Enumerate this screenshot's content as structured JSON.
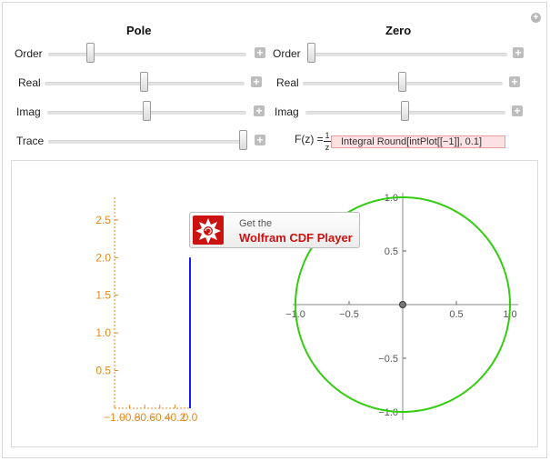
{
  "pole": {
    "title": "Pole",
    "rows": [
      {
        "label": "Order",
        "value": 0.22
      },
      {
        "label": "Real",
        "value": 0.5
      },
      {
        "label": "Imag",
        "value": 0.5
      },
      {
        "label": "Trace",
        "value": 1.0
      }
    ]
  },
  "zero": {
    "title": "Zero",
    "rows": [
      {
        "label": "Order",
        "value": 0.0
      },
      {
        "label": "Real",
        "value": 0.5
      },
      {
        "label": "Imag",
        "value": 0.5
      }
    ]
  },
  "buttons": {
    "plus": "+"
  },
  "formula": {
    "lhs": "F(z) =",
    "numerator": "1",
    "denominator": "z",
    "error_text": "Integral    Round[intPlot[[−1]], 0.1]"
  },
  "cdf_badge": {
    "line1": "Get the",
    "line2": "Wolfram CDF Player"
  },
  "colors": {
    "axis_orange": "#e28a1c",
    "trace_blue": "#1a1aff",
    "circle_green": "#33cc11",
    "error_fill": "#fbe1e1"
  },
  "chart_data": [
    {
      "type": "line",
      "x_ticks": [
        "−1.0",
        "−0.8",
        "−0.6",
        "−0.4",
        "−0.2",
        "0.0"
      ],
      "y_ticks": [
        "0.5",
        "1.0",
        "1.5",
        "2.0",
        "2.5"
      ],
      "series": [
        {
          "x": [
            0,
            0
          ],
          "y": [
            0,
            2.0
          ]
        }
      ],
      "xlim": [
        -1.0,
        0.0
      ],
      "ylim": [
        0,
        2.8
      ]
    },
    {
      "type": "line",
      "x_ticks": [
        "−1.0",
        "−0.5",
        "0.5",
        "1.0"
      ],
      "y_ticks": [
        "1.0",
        "0.5",
        "−0.5",
        "−1.0"
      ],
      "circle": {
        "center": [
          0,
          0
        ],
        "radius": 1.0
      },
      "point": [
        0,
        0
      ],
      "xlim": [
        -1.0,
        1.0
      ],
      "ylim": [
        -1.0,
        1.0
      ]
    }
  ]
}
